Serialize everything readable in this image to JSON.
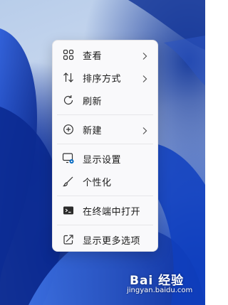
{
  "context_menu": {
    "items": [
      {
        "label": "查看",
        "icon": "grid-icon",
        "has_submenu": true
      },
      {
        "label": "排序方式",
        "icon": "sort-icon",
        "has_submenu": true
      },
      {
        "label": "刷新",
        "icon": "refresh-icon",
        "has_submenu": false
      },
      {
        "label": "新建",
        "icon": "add-circle-icon",
        "has_submenu": true
      },
      {
        "label": "显示设置",
        "icon": "display-settings-icon",
        "has_submenu": false
      },
      {
        "label": "个性化",
        "icon": "brush-icon",
        "has_submenu": false
      },
      {
        "label": "在终端中打开",
        "icon": "terminal-icon",
        "has_submenu": false
      },
      {
        "label": "显示更多选项",
        "icon": "open-external-icon",
        "has_submenu": false
      }
    ]
  },
  "watermark": {
    "logo_text": "Bai 经验",
    "url_text": "jingyan.baidu.com"
  },
  "colors": {
    "menu_bg": "#f9f9fb",
    "text": "#1b1b1b",
    "accent_blue": "#0067c0"
  }
}
